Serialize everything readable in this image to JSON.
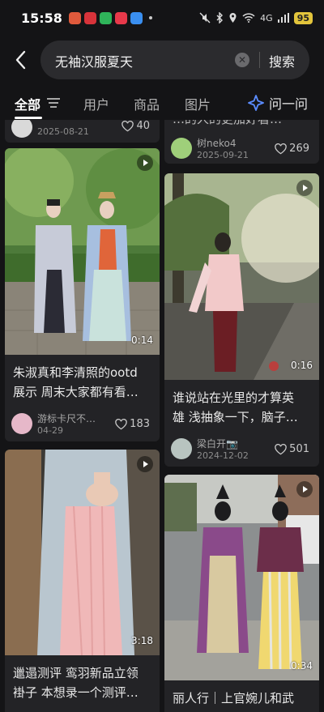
{
  "status_bar": {
    "time": "15:58",
    "signal": "4G",
    "battery": "95"
  },
  "search": {
    "query": "无袖汉服夏天",
    "clear_icon": "clear-icon",
    "button_label": "搜索"
  },
  "tabs": {
    "all": "全部",
    "users": "用户",
    "products": "商品",
    "images": "图片",
    "ask": "问一问"
  },
  "feed": {
    "left": [
      {
        "date": "2025-08-21",
        "likes": "40"
      },
      {
        "duration": "0:14",
        "title_line1": "朱淑真和李清照的ootd",
        "title_line2": "展示 周末大家都有看…",
        "author": "游标卡尺不…",
        "date": "04-29",
        "likes": "183"
      },
      {
        "duration": "3:18",
        "title_line1": "邋遢测评 鸾羽新品立领",
        "title_line2": "褂子 本想录一个测评…"
      }
    ],
    "right": [
      {
        "title_partial": "…的人的更加好看…",
        "author": "树neko4",
        "date": "2025-09-21",
        "likes": "269"
      },
      {
        "duration": "0:16",
        "title_line1": "谁说站在光里的才算英",
        "title_line2": "雄 浅抽象一下，脑子…",
        "author": "梁白开📷",
        "date": "2024-12-02",
        "likes": "501"
      },
      {
        "duration": "0:34",
        "title_line1": "丽人行｜上官婉儿和武"
      }
    ]
  },
  "colors": {
    "background": "#141416",
    "card": "#232326",
    "accent_ask": "#5b8cff"
  }
}
